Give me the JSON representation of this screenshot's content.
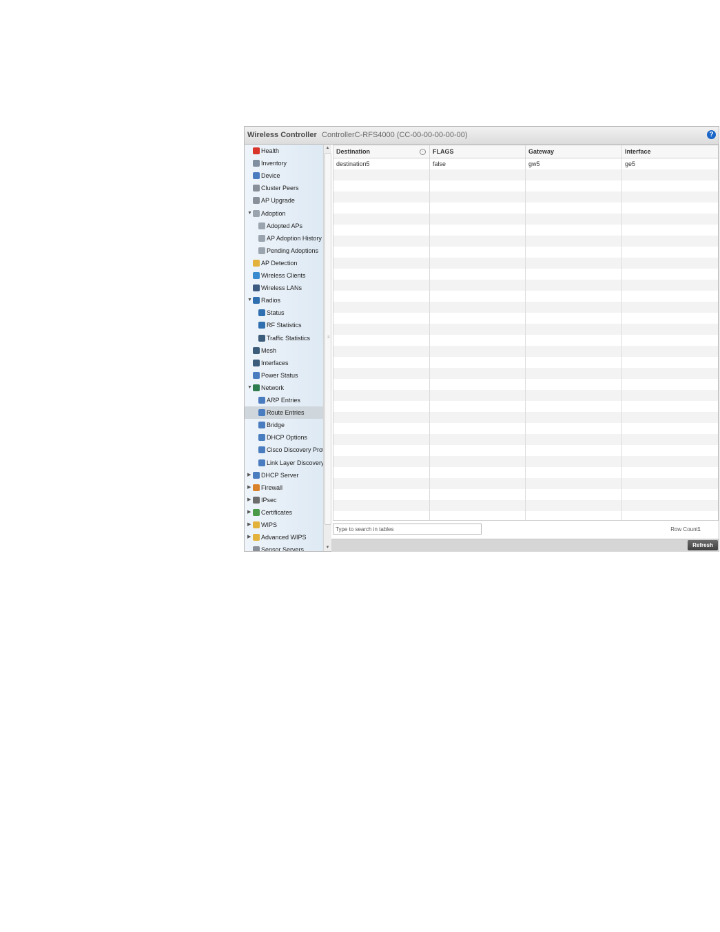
{
  "window": {
    "title": "Wireless Controller",
    "subtitle": "ControllerC-RFS4000 (CC-00-00-00-00-00)",
    "help_icon": "question-circle-icon",
    "help_glyph": "?"
  },
  "sidebar": {
    "items": [
      {
        "label": "Health",
        "icon": "health-icon",
        "color": "#d9352a",
        "level": 0,
        "arrow": ""
      },
      {
        "label": "Inventory",
        "icon": "inventory-icon",
        "color": "#7f8fa0",
        "level": 0,
        "arrow": ""
      },
      {
        "label": "Device",
        "icon": "device-icon",
        "color": "#4a7cc0",
        "level": 0,
        "arrow": ""
      },
      {
        "label": "Cluster Peers",
        "icon": "cluster-peers-icon",
        "color": "#8a9099",
        "level": 0,
        "arrow": ""
      },
      {
        "label": "AP Upgrade",
        "icon": "ap-upgrade-icon",
        "color": "#8a9099",
        "level": 0,
        "arrow": ""
      },
      {
        "label": "Adoption",
        "icon": "adoption-icon",
        "color": "#9aa4ae",
        "level": 0,
        "arrow": "▼"
      },
      {
        "label": "Adopted APs",
        "icon": "adopted-aps-icon",
        "color": "#9aa4ae",
        "level": 1,
        "arrow": ""
      },
      {
        "label": "AP Adoption History",
        "icon": "ap-adoption-history-icon",
        "color": "#9aa4ae",
        "level": 1,
        "arrow": ""
      },
      {
        "label": "Pending Adoptions",
        "icon": "pending-adoptions-icon",
        "color": "#9aa4ae",
        "level": 1,
        "arrow": ""
      },
      {
        "label": "AP Detection",
        "icon": "ap-detection-icon",
        "color": "#e3b23c",
        "level": 0,
        "arrow": ""
      },
      {
        "label": "Wireless Clients",
        "icon": "wireless-clients-icon",
        "color": "#3a8ad0",
        "level": 0,
        "arrow": ""
      },
      {
        "label": "Wireless LANs",
        "icon": "wireless-lans-icon",
        "color": "#3d5a80",
        "level": 0,
        "arrow": ""
      },
      {
        "label": "Radios",
        "icon": "radios-icon",
        "color": "#2f6fb0",
        "level": 0,
        "arrow": "▼"
      },
      {
        "label": "Status",
        "icon": "radio-status-icon",
        "color": "#2f6fb0",
        "level": 1,
        "arrow": ""
      },
      {
        "label": "RF Statistics",
        "icon": "rf-statistics-icon",
        "color": "#2f6fb0",
        "level": 1,
        "arrow": ""
      },
      {
        "label": "Traffic Statistics",
        "icon": "traffic-statistics-icon",
        "color": "#3b5c7a",
        "level": 1,
        "arrow": ""
      },
      {
        "label": "Mesh",
        "icon": "mesh-icon",
        "color": "#3b5c7a",
        "level": 0,
        "arrow": ""
      },
      {
        "label": "Interfaces",
        "icon": "interfaces-icon",
        "color": "#3b5c7a",
        "level": 0,
        "arrow": ""
      },
      {
        "label": "Power Status",
        "icon": "power-status-icon",
        "color": "#4a7cc0",
        "level": 0,
        "arrow": ""
      },
      {
        "label": "Network",
        "icon": "network-icon",
        "color": "#2e7d4f",
        "level": 0,
        "arrow": "▼"
      },
      {
        "label": "ARP Entries",
        "icon": "arp-entries-icon",
        "color": "#4a7cc0",
        "level": 1,
        "arrow": ""
      },
      {
        "label": "Route Entries",
        "icon": "route-entries-icon",
        "color": "#4a7cc0",
        "level": 1,
        "arrow": "",
        "selected": true
      },
      {
        "label": "Bridge",
        "icon": "bridge-icon",
        "color": "#4a7cc0",
        "level": 1,
        "arrow": ""
      },
      {
        "label": "DHCP Options",
        "icon": "dhcp-options-icon",
        "color": "#4a7cc0",
        "level": 1,
        "arrow": ""
      },
      {
        "label": "Cisco Discovery Prot",
        "icon": "cisco-discovery-icon",
        "color": "#4a7cc0",
        "level": 1,
        "arrow": ""
      },
      {
        "label": "Link Layer Discovery",
        "icon": "link-layer-discovery-icon",
        "color": "#4a7cc0",
        "level": 1,
        "arrow": ""
      },
      {
        "label": "DHCP Server",
        "icon": "dhcp-server-icon",
        "color": "#4a7cc0",
        "level": 0,
        "arrow": "▶"
      },
      {
        "label": "Firewall",
        "icon": "firewall-icon",
        "color": "#d9822b",
        "level": 0,
        "arrow": "▶"
      },
      {
        "label": "IPsec",
        "icon": "ipsec-icon",
        "color": "#6d6d6d",
        "level": 0,
        "arrow": "▶"
      },
      {
        "label": "Certificates",
        "icon": "certificates-icon",
        "color": "#4a9a4a",
        "level": 0,
        "arrow": "▶"
      },
      {
        "label": "WIPS",
        "icon": "wips-icon",
        "color": "#e3b23c",
        "level": 0,
        "arrow": "▶"
      },
      {
        "label": "Advanced WIPS",
        "icon": "advanced-wips-icon",
        "color": "#e3b23c",
        "level": 0,
        "arrow": "▶"
      },
      {
        "label": "Sensor Servers",
        "icon": "sensor-servers-icon",
        "color": "#8a9099",
        "level": 0,
        "arrow": ""
      }
    ]
  },
  "table": {
    "columns": [
      "Destination",
      "FLAGS",
      "Gateway",
      "Interface"
    ],
    "rows": [
      [
        "destination5",
        "false",
        "gw5",
        "ge5"
      ]
    ],
    "sort_icon": "sort-icon",
    "search_placeholder": "Type to search in tables",
    "row_count_label": "Row Count:",
    "row_count": "1"
  },
  "buttons": {
    "refresh": "Refresh"
  }
}
